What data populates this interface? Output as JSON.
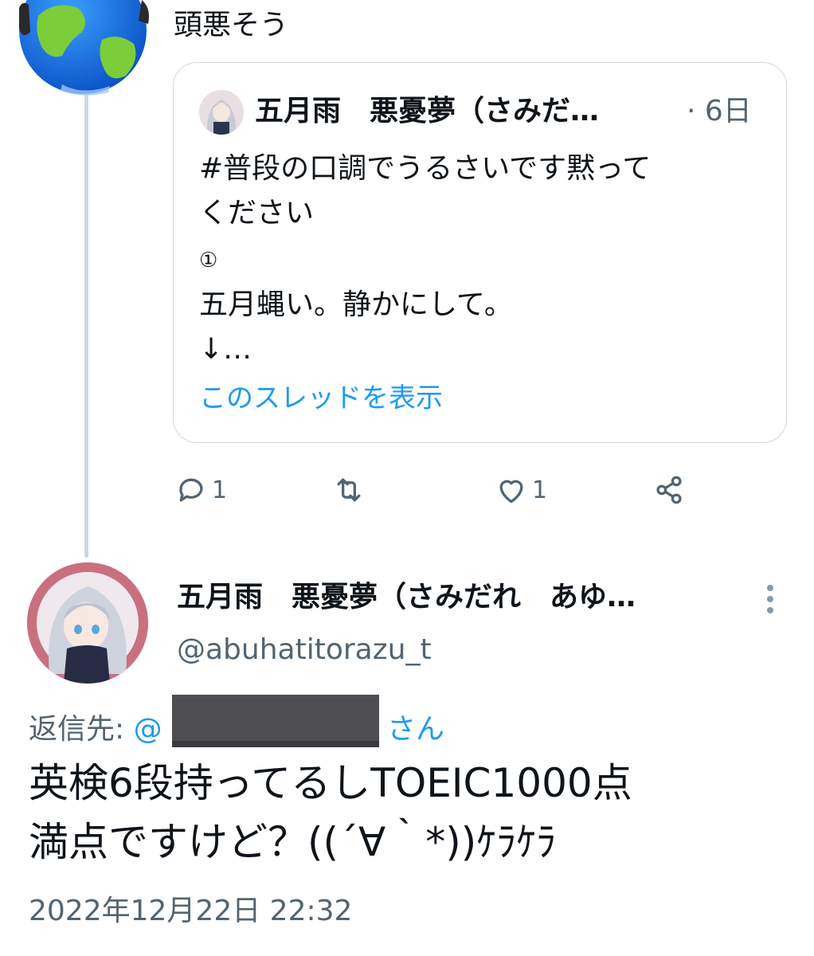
{
  "previous_post": {
    "text": "頭悪そう"
  },
  "quoted_post": {
    "author_name": "五月雨　悪憂夢（さみだ…",
    "time": "· 6日",
    "body": "#普段の口調でうるさいです黙って\nください",
    "marker": "①",
    "body2": "五月蝿い。静かにして。\n↓…",
    "show_thread_link": "このスレッドを表示"
  },
  "actions": {
    "reply_count": "1",
    "like_count": "1"
  },
  "main_post": {
    "author_name": "五月雨　悪憂夢（さみだれ　あゆ…",
    "handle": "@abuhatitorazu_t",
    "reply_label": "返信先: ",
    "reply_at": "@",
    "reply_suffix": "さん",
    "text": "英検6段持ってるしTOEIC1000点\n満点ですけど？((´∀｀*))ｹﾗｹﾗ",
    "timestamp": "2022年12月22日 22:32"
  },
  "colors": {
    "link": "#1d9bf0",
    "secondary_text": "#536471",
    "border": "#cfd9de"
  }
}
